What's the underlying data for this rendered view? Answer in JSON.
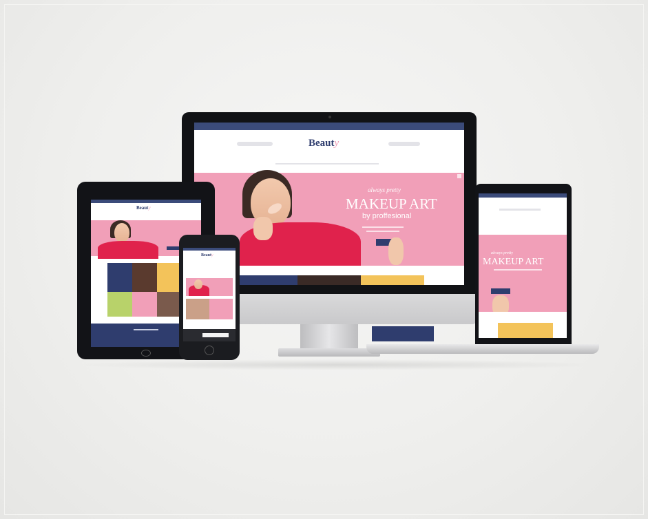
{
  "site": {
    "logo_main": "Beaut",
    "logo_accent": "y"
  },
  "hero": {
    "script_line": "always pretty",
    "headline": "MAKEUP ART",
    "subline": "by proffesional",
    "cta": ""
  },
  "colors": {
    "topbar": "#3b4b7a",
    "pink": "#f19fb8",
    "navy": "#2f3d6e",
    "yellow": "#f3c35a",
    "dress": "#e0224c"
  },
  "devices": [
    "desktop-monitor",
    "laptop",
    "tablet",
    "phone"
  ]
}
